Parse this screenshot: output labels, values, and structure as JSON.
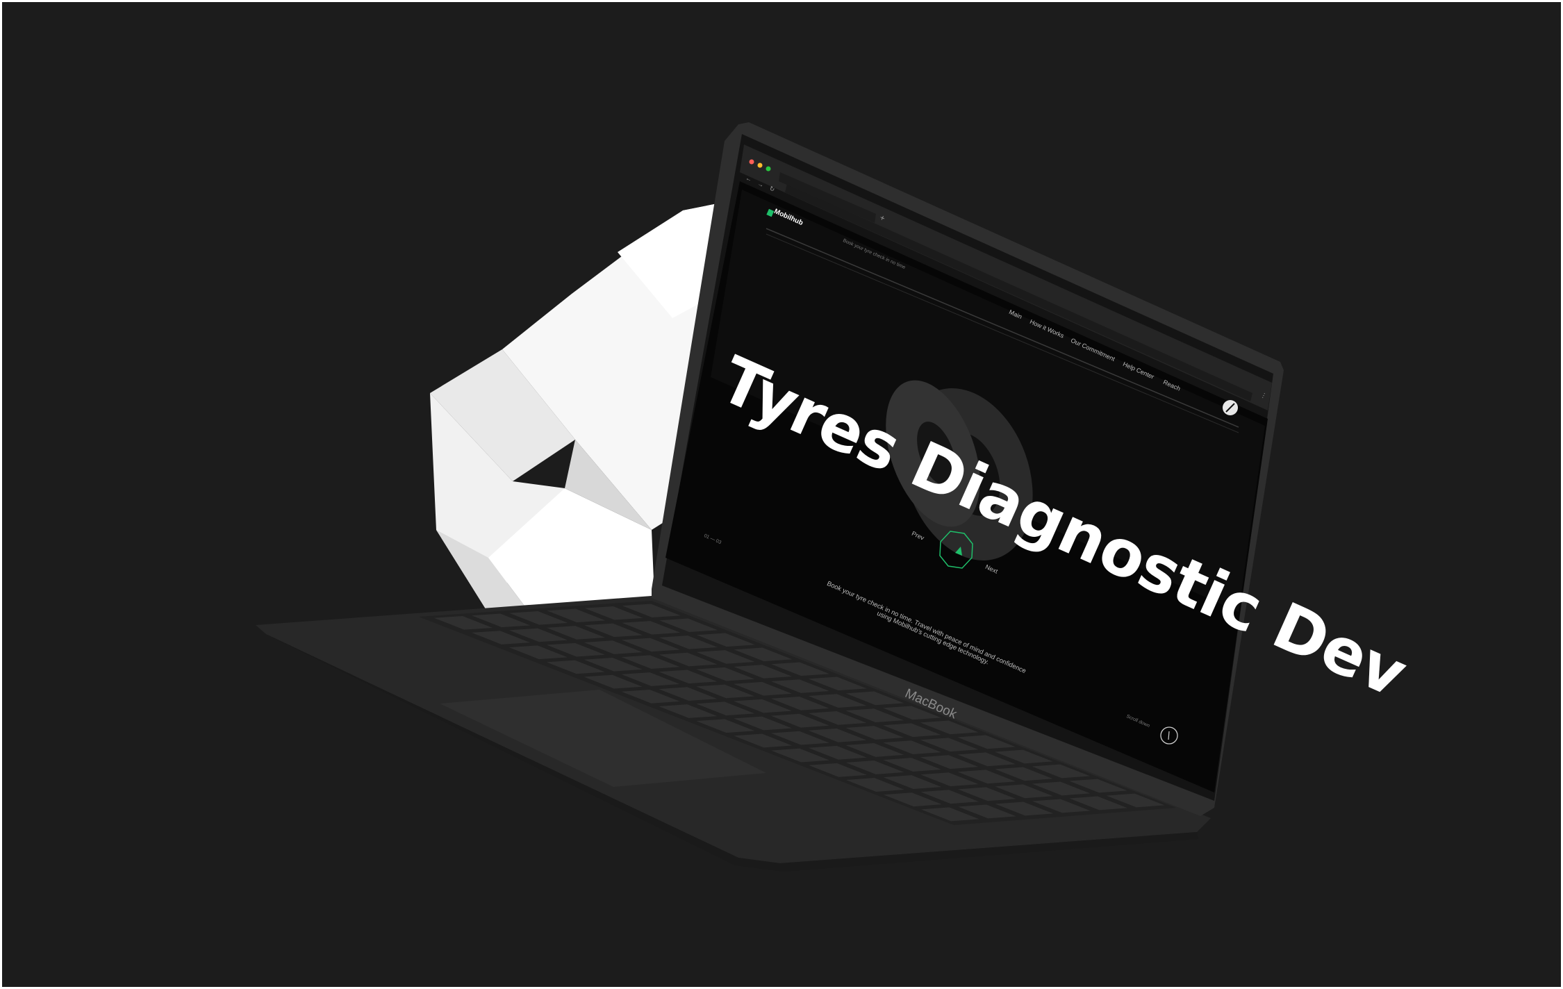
{
  "browser": {
    "new_tab_symbol": "+",
    "nav_back_symbol": "←",
    "nav_forward_symbol": "→",
    "reload_symbol": "↻",
    "menu_symbol": "⋮"
  },
  "site": {
    "logo_text": "Mobilhub",
    "tagline": "Book your tyre check in no time",
    "nav": [
      "Main",
      "How it Works",
      "Our Commitment",
      "Help Center",
      "Reach"
    ],
    "hero_title": "Tyres Diagnostic Dev",
    "prev_label": "Prev",
    "next_label": "Next",
    "slide_counter": "01 — 03",
    "description_line1": "Book your tyre check in no time. Travel with peace of mind and confidence",
    "description_line2": "using Mobilhub's cutting edge technology.",
    "scroll_label": "Scroll down",
    "accent_color": "#1fbf6a"
  },
  "device": {
    "brand_label": "MacBook"
  },
  "colors": {
    "background": "#1c1c1c",
    "laptop_body": "#2b2b2b",
    "screen": "#050505",
    "paper": "#f4f4f4"
  }
}
